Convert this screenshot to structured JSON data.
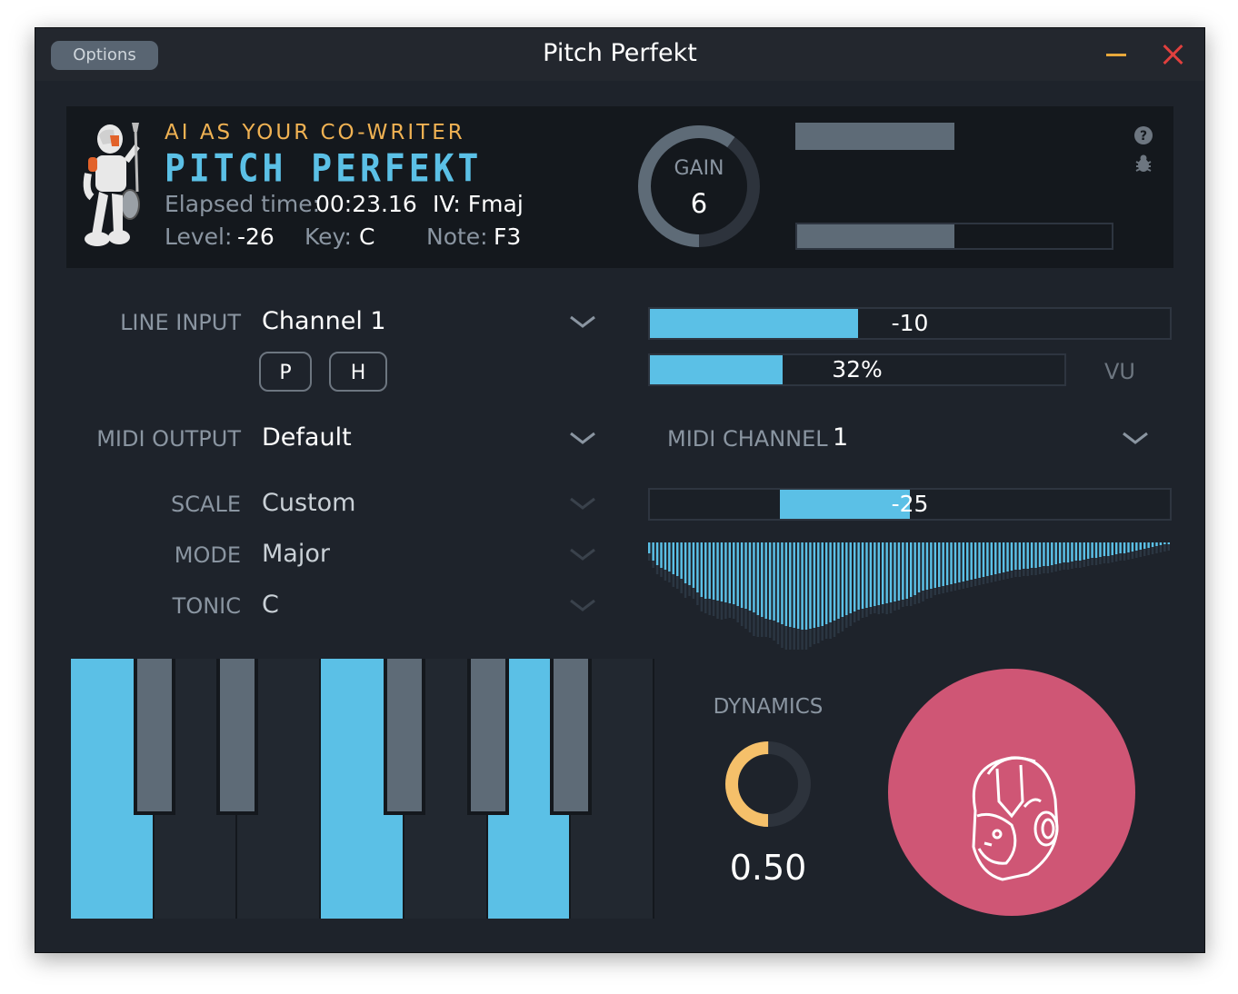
{
  "window": {
    "title": "Pitch Perfekt",
    "options_label": "Options"
  },
  "header": {
    "tagline": "AI AS YOUR CO-WRITER",
    "logo_text": "PITCH PERFEKT",
    "elapsed_label": "Elapsed time:",
    "elapsed_value": "00:23.16",
    "chord": "IV: Fmaj",
    "level_label": "Level:",
    "level_value": "-26",
    "key_label": "Key:",
    "key_value": "C",
    "note_label": "Note:",
    "note_value": "F3",
    "gain_label": "GAIN",
    "gain_value": "6",
    "gain_fraction": 0.6,
    "meter_top_fraction": 0.5,
    "meter_bottom_fraction": 0.5,
    "help_icon": "question-icon",
    "bug_icon": "bug-icon"
  },
  "controls": {
    "line_input_label": "LINE INPUT",
    "line_input_value": "Channel 1",
    "p_label": "P",
    "h_label": "H",
    "midi_output_label": "MIDI OUTPUT",
    "midi_output_value": "Default",
    "scale_label": "SCALE",
    "scale_value": "Custom",
    "mode_label": "MODE",
    "mode_value": "Major",
    "tonic_label": "TONIC",
    "tonic_value": "C",
    "midi_channel_label": "MIDI CHANNEL",
    "midi_channel_value": "1"
  },
  "meters": {
    "input_value": "-10",
    "input_fraction": 0.4,
    "vu_value": "32%",
    "vu_fraction": 0.32,
    "vu_label": "VU",
    "pitch_value": "-25",
    "pitch_from": 0.25,
    "pitch_to": 0.5
  },
  "waveform": {
    "base_depth": [
      12,
      20,
      25,
      28,
      30,
      32,
      35,
      37,
      40,
      45,
      47,
      50,
      55,
      60,
      62,
      62,
      63,
      64,
      65,
      66,
      67,
      68,
      70,
      72,
      73,
      75,
      77,
      80,
      82,
      84,
      85,
      86,
      88,
      90,
      92,
      93,
      94,
      95,
      96,
      96,
      95,
      94,
      93,
      92,
      90,
      88,
      86,
      84,
      82,
      80,
      78,
      76,
      74,
      73,
      72,
      71,
      70,
      69,
      68,
      67,
      66,
      65,
      64,
      63,
      62,
      60,
      58,
      55,
      53,
      52,
      51,
      50,
      49,
      48,
      47,
      46,
      45,
      44,
      43,
      42,
      41,
      40,
      39,
      38,
      37,
      36,
      35,
      34,
      33,
      32,
      31,
      30,
      30,
      29,
      29,
      28,
      28,
      27,
      26,
      26,
      25,
      24,
      23,
      22,
      22,
      21,
      20,
      20,
      19,
      18,
      17,
      17,
      16,
      15,
      15,
      14,
      13,
      12,
      12,
      11,
      10,
      9,
      8,
      7,
      6,
      5,
      4,
      3,
      2,
      1
    ],
    "dark_extra": [
      4,
      4,
      6,
      6,
      8,
      8,
      10,
      10,
      12,
      12,
      8,
      8,
      10,
      12,
      12,
      14,
      14,
      16,
      16,
      14,
      12,
      12,
      14,
      16,
      18,
      20,
      22,
      20,
      18,
      16,
      16,
      18,
      20,
      22,
      24,
      26,
      24,
      22,
      20,
      18,
      16,
      14,
      14,
      12,
      12,
      14,
      14,
      12,
      12,
      10,
      10,
      8,
      8,
      6,
      6,
      4,
      4,
      6,
      6,
      8,
      8,
      6,
      6,
      4,
      4,
      6,
      6,
      8,
      8,
      6,
      6,
      4,
      4,
      4,
      4,
      4,
      4,
      4,
      4,
      4,
      4,
      4,
      4,
      4,
      4,
      4,
      4,
      4,
      4,
      4,
      4,
      4,
      4,
      4,
      4,
      4,
      4,
      4,
      4,
      4,
      4,
      4,
      4,
      4,
      4,
      4,
      4,
      4,
      4,
      4,
      4,
      4,
      4,
      4,
      4,
      4,
      4,
      4,
      4,
      4,
      4,
      4,
      4,
      4,
      4,
      4,
      4,
      4,
      4,
      4
    ]
  },
  "dynamics": {
    "label": "DYNAMICS",
    "value": "0.50",
    "fraction": 0.5
  },
  "piano": {
    "white_keys": [
      true,
      false,
      false,
      true,
      false,
      true,
      false
    ],
    "black_keys": [
      true,
      true,
      true,
      true,
      true
    ]
  },
  "colors": {
    "accent_blue": "#5bc0e6",
    "accent_orange": "#f5c06a",
    "record_pink": "#cf5675",
    "tagline_orange": "#f0b253"
  },
  "record_button": {
    "icon": "robot-head-icon"
  }
}
